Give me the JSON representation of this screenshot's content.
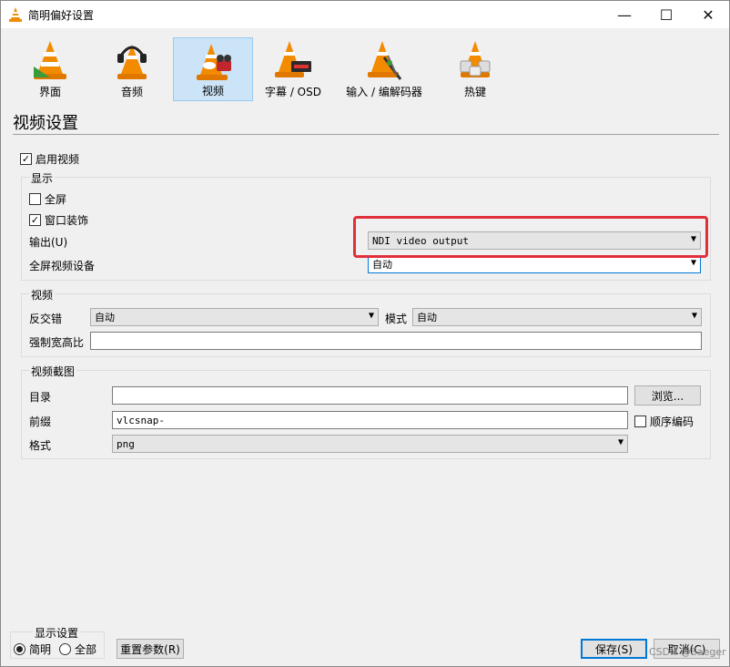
{
  "window": {
    "title": "简明偏好设置",
    "minimize": "—",
    "maximize": "☐",
    "close": "✕"
  },
  "categories": [
    {
      "label": "界面"
    },
    {
      "label": "音频"
    },
    {
      "label": "视频"
    },
    {
      "label": "字幕 / OSD"
    },
    {
      "label": "输入 / 编解码器"
    },
    {
      "label": "热键"
    }
  ],
  "section_title": "视频设置",
  "enable_video": {
    "label": "启用视频",
    "checked": true
  },
  "display": {
    "title": "显示",
    "fullscreen": {
      "label": "全屏",
      "checked": false
    },
    "window_decorations": {
      "label": "窗口装饰",
      "checked": true
    },
    "output_label": "输出(U)",
    "output_value": "NDI video output",
    "fs_device_label": "全屏视频设备",
    "fs_device_value": "自动"
  },
  "video": {
    "title": "视频",
    "deinterlace_label": "反交错",
    "deinterlace_value": "自动",
    "mode_label": "模式",
    "mode_value": "自动",
    "aspect_label": "强制宽高比",
    "aspect_value": ""
  },
  "snapshot": {
    "title": "视频截图",
    "dir_label": "目录",
    "dir_value": "",
    "browse_label": "浏览...",
    "prefix_label": "前缀",
    "prefix_value": "vlcsnap-",
    "sequential_label": "顺序编码",
    "sequential_checked": false,
    "format_label": "格式",
    "format_value": "png"
  },
  "show_settings": {
    "title": "显示设置",
    "simple_label": "简明",
    "all_label": "全部",
    "selected": "simple"
  },
  "buttons": {
    "reset": "重置参数(R)",
    "save": "保存(S)",
    "cancel": "取消(C)"
  },
  "watermark": "CSDN @Saeger",
  "colors": {
    "highlight": "#e0303a",
    "selected_tab": "#cce4f7",
    "vlc_orange": "#f38b00"
  }
}
